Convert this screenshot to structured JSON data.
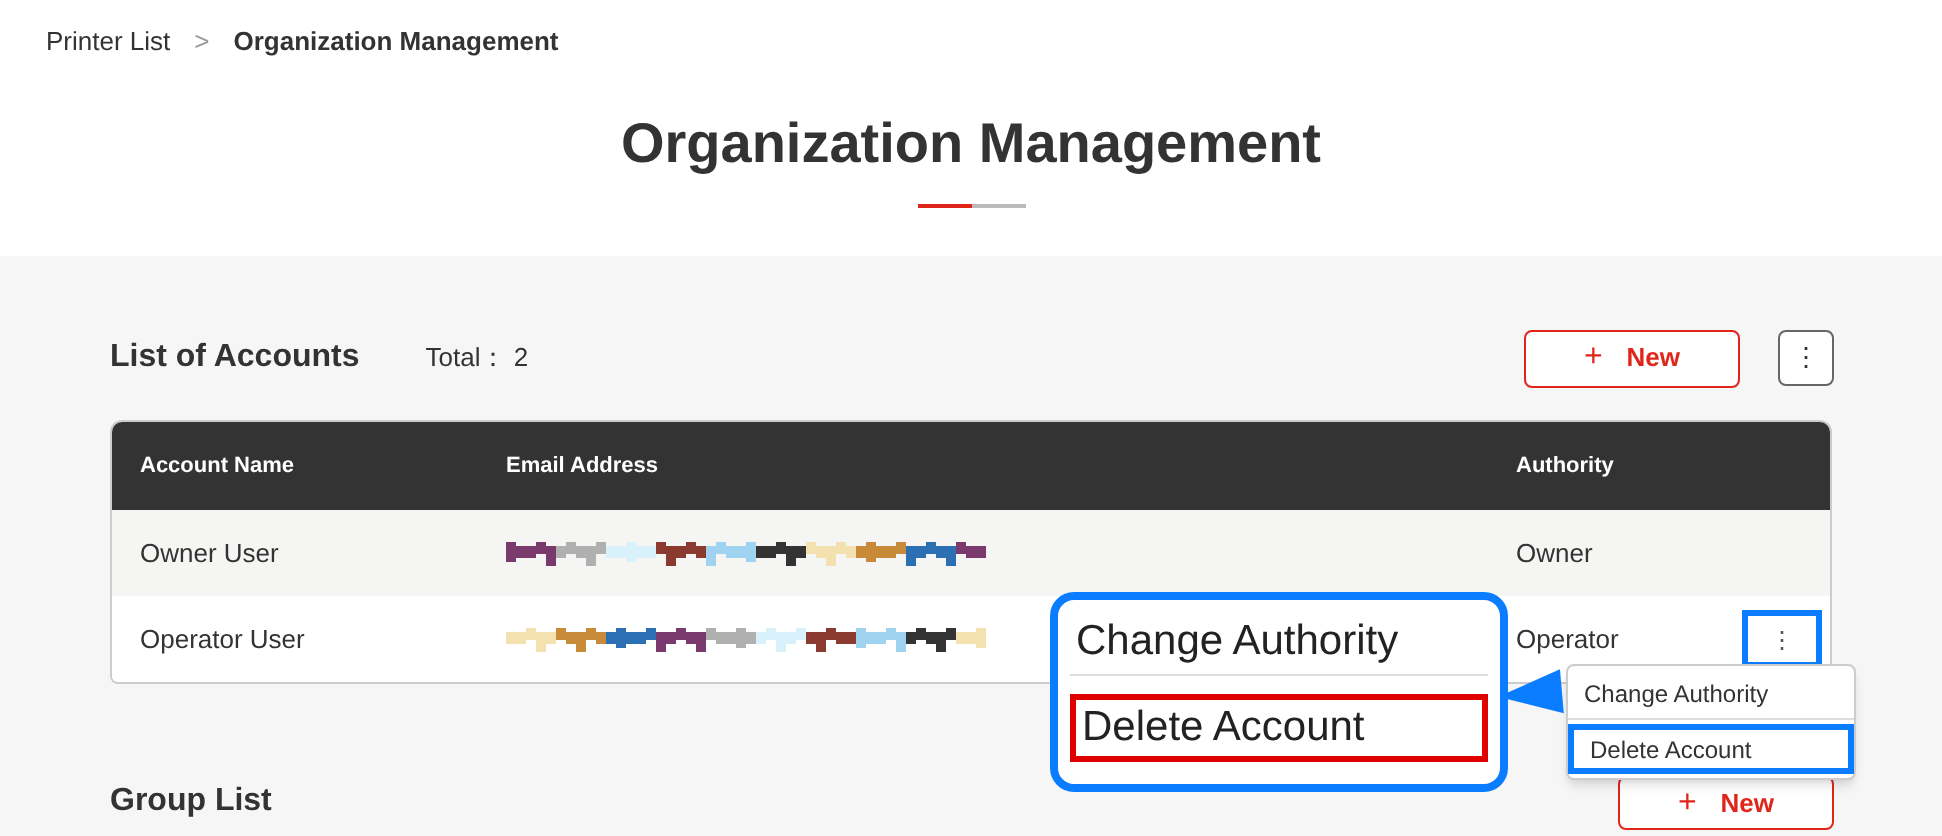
{
  "breadcrumb": [
    {
      "label": "Printer List"
    },
    {
      "label": "Organization Management"
    }
  ],
  "breadcrumb_separator": ">",
  "page_title": "Organization Management",
  "accounts": {
    "title": "List of Accounts",
    "total_label": "Total：",
    "total": "2",
    "new_button": {
      "icon": "+",
      "label": "New"
    },
    "more_button": "⋮",
    "table": {
      "columns": [
        "Account Name",
        "Email Address",
        "Authority"
      ],
      "rows": [
        {
          "name": "Owner User",
          "email": {
            "kind": "pixelated"
          },
          "authority": "Owner"
        },
        {
          "name": "Operator User",
          "email": {
            "kind": "pixelated"
          },
          "authority": "Operator",
          "menu_button": {
            "label": "⋮",
            "highlighted": true
          }
        }
      ]
    }
  },
  "row_menu": {
    "items": [
      {
        "label": "Change Authority",
        "highlighted": false
      },
      {
        "label": "Delete Account",
        "highlighted": true
      }
    ]
  },
  "callout": {
    "items": [
      {
        "label": "Change Authority",
        "highlighted": false
      },
      {
        "label": "Delete Account",
        "highlighted": true
      }
    ]
  },
  "groups": {
    "title": "Group List",
    "new_button": {
      "icon": "+",
      "label": "New"
    }
  }
}
